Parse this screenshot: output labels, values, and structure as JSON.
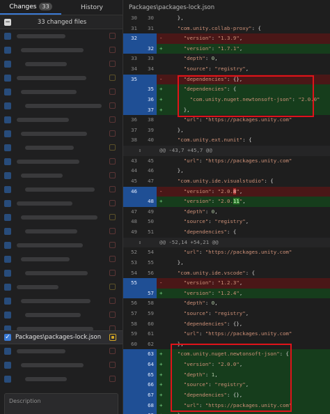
{
  "tabs": {
    "changes_label": "Changes",
    "changes_count": "33",
    "history_label": "History"
  },
  "changed_files_label": "33 changed files",
  "selected_file": "Packages\\packages-lock.json",
  "description_placeholder": "Description",
  "diff_path": "Packages\\packages-lock.json",
  "colors": {
    "accent": "#3b7bd6",
    "deleted_bg": "#4a1717",
    "added_bg": "#163d1c",
    "gutter_changed": "#1f4f95",
    "annotation": "#e0131a",
    "modified_status": "#d4a625"
  },
  "icons": {
    "expand_hunk": "expand-arrows-icon",
    "file_status": "modified-file-icon"
  },
  "diff_lines": [
    {
      "t": "ctx",
      "o": "30",
      "n": "30",
      "c": "    },",
      "partial": true
    },
    {
      "t": "ctx",
      "o": "31",
      "n": "31",
      "c": "    \"com.unity.collab-proxy\": {"
    },
    {
      "t": "del",
      "o": "32",
      "n": "",
      "c": "      \"version\": \"1.3.9\","
    },
    {
      "t": "add",
      "o": "",
      "n": "32",
      "c": "      \"version\": \"1.7.1\","
    },
    {
      "t": "ctx",
      "o": "33",
      "n": "33",
      "c": "      \"depth\": 0,"
    },
    {
      "t": "ctx",
      "o": "34",
      "n": "34",
      "c": "      \"source\": \"registry\","
    },
    {
      "t": "del",
      "o": "35",
      "n": "",
      "c": "      \"dependencies\": {},"
    },
    {
      "t": "add",
      "o": "",
      "n": "35",
      "c": "      \"dependencies\": {"
    },
    {
      "t": "add",
      "o": "",
      "n": "36",
      "c": "        \"com.unity.nuget.newtonsoft-json\": \"2.0.0\""
    },
    {
      "t": "add",
      "o": "",
      "n": "37",
      "c": "      },"
    },
    {
      "t": "ctx",
      "o": "36",
      "n": "38",
      "c": "      \"url\": \"https://packages.unity.com\""
    },
    {
      "t": "ctx",
      "o": "37",
      "n": "39",
      "c": "    },"
    },
    {
      "t": "ctx",
      "o": "38",
      "n": "40",
      "c": "    \"com.unity.ext.nunit\": {"
    },
    {
      "t": "hunk",
      "c": "@@ -43,7 +45,7 @@"
    },
    {
      "t": "ctx",
      "o": "43",
      "n": "45",
      "c": "      \"url\": \"https://packages.unity.com\""
    },
    {
      "t": "ctx",
      "o": "44",
      "n": "46",
      "c": "    },"
    },
    {
      "t": "ctx",
      "o": "45",
      "n": "47",
      "c": "    \"com.unity.ide.visualstudio\": {"
    },
    {
      "t": "del",
      "o": "46",
      "n": "",
      "c": "      \"version\": \"2.0.8\","
    },
    {
      "t": "add",
      "o": "",
      "n": "48",
      "c": "      \"version\": \"2.0.11\","
    },
    {
      "t": "ctx",
      "o": "47",
      "n": "49",
      "c": "      \"depth\": 0,"
    },
    {
      "t": "ctx",
      "o": "48",
      "n": "50",
      "c": "      \"source\": \"registry\","
    },
    {
      "t": "ctx",
      "o": "49",
      "n": "51",
      "c": "      \"dependencies\": {"
    },
    {
      "t": "hunk",
      "c": "@@ -52,14 +54,21 @@"
    },
    {
      "t": "ctx",
      "o": "52",
      "n": "54",
      "c": "      \"url\": \"https://packages.unity.com\""
    },
    {
      "t": "ctx",
      "o": "53",
      "n": "55",
      "c": "    },"
    },
    {
      "t": "ctx",
      "o": "54",
      "n": "56",
      "c": "    \"com.unity.ide.vscode\": {"
    },
    {
      "t": "del",
      "o": "55",
      "n": "",
      "c": "      \"version\": \"1.2.3\","
    },
    {
      "t": "add",
      "o": "",
      "n": "57",
      "c": "      \"version\": \"1.2.4\","
    },
    {
      "t": "ctx",
      "o": "56",
      "n": "58",
      "c": "      \"depth\": 0,"
    },
    {
      "t": "ctx",
      "o": "57",
      "n": "59",
      "c": "      \"source\": \"registry\","
    },
    {
      "t": "ctx",
      "o": "58",
      "n": "60",
      "c": "      \"dependencies\": {},"
    },
    {
      "t": "ctx",
      "o": "59",
      "n": "61",
      "c": "      \"url\": \"https://packages.unity.com\""
    },
    {
      "t": "ctx",
      "o": "60",
      "n": "62",
      "c": "    },"
    },
    {
      "t": "add",
      "o": "",
      "n": "63",
      "c": "    \"com.unity.nuget.newtonsoft-json\": {"
    },
    {
      "t": "add",
      "o": "",
      "n": "64",
      "c": "      \"version\": \"2.0.0\","
    },
    {
      "t": "add",
      "o": "",
      "n": "65",
      "c": "      \"depth\": 1,"
    },
    {
      "t": "add",
      "o": "",
      "n": "66",
      "c": "      \"source\": \"registry\","
    },
    {
      "t": "add",
      "o": "",
      "n": "67",
      "c": "      \"dependencies\": {},"
    },
    {
      "t": "add",
      "o": "",
      "n": "68",
      "c": "      \"url\": \"https://packages.unity.com\""
    },
    {
      "t": "add",
      "o": "",
      "n": "69",
      "c": "    },"
    }
  ]
}
